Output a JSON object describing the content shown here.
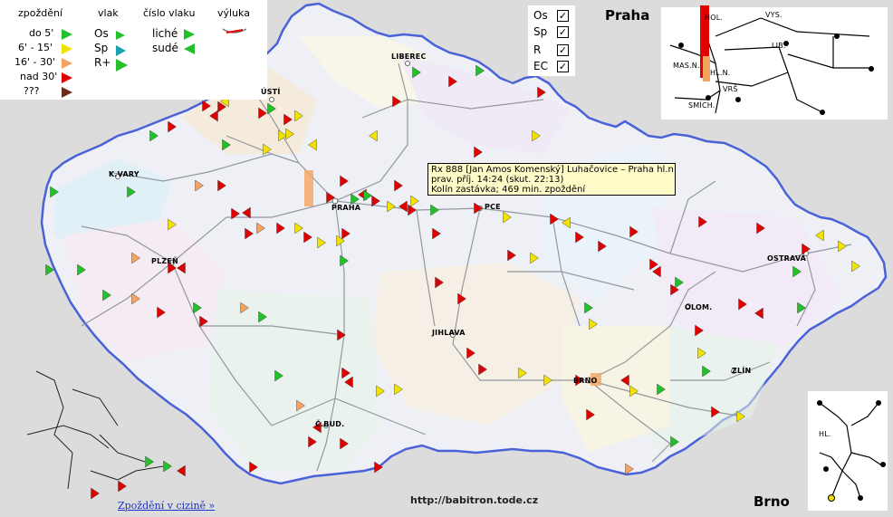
{
  "legend": {
    "delay_header": "zpoždění",
    "delays": [
      {
        "label": "do 5'",
        "color": "#22c02a",
        "icon": "delay-up-to-5-icon"
      },
      {
        "label": "6' - 15'",
        "color": "#f2e200",
        "icon": "delay-6-15-icon"
      },
      {
        "label": "16' - 30'",
        "color": "#f4a460",
        "icon": "delay-16-30-icon"
      },
      {
        "label": "nad 30'",
        "color": "#e00000",
        "icon": "delay-over-30-icon"
      },
      {
        "label": "???",
        "color": "#6b2c1a",
        "icon": "delay-unknown-icon"
      }
    ],
    "train_header": "vlak",
    "trains": [
      {
        "label": "Os",
        "color": "#22c02a",
        "icon": "train-os-icon"
      },
      {
        "label": "Sp",
        "color": "#1aa0b0",
        "icon": "train-sp-icon"
      },
      {
        "label": "R+",
        "color": "#22c02a",
        "icon": "train-r-icon"
      }
    ],
    "number_header": "číslo vlaku",
    "numbers": [
      {
        "label": "liché",
        "icon": "odd-number-icon"
      },
      {
        "label": "sudé",
        "icon": "even-number-icon"
      }
    ],
    "closure_header": "výluka"
  },
  "filters": [
    {
      "label": "Os",
      "checked": true
    },
    {
      "label": "Sp",
      "checked": true
    },
    {
      "label": "R",
      "checked": true
    },
    {
      "label": "EC",
      "checked": true
    }
  ],
  "cities": [
    {
      "name": "LIBEREC"
    },
    {
      "name": "ÚSTÍ"
    },
    {
      "name": "K.VARY"
    },
    {
      "name": "PRAHA"
    },
    {
      "name": "PCE"
    },
    {
      "name": "PLZEŇ"
    },
    {
      "name": "JIHLAVA"
    },
    {
      "name": "OSTRAVA"
    },
    {
      "name": "OLOM."
    },
    {
      "name": "BRNO"
    },
    {
      "name": "ZLÍN"
    },
    {
      "name": "Č.BUD."
    }
  ],
  "praha_inset": {
    "title": "Praha",
    "labels": [
      "HOL.",
      "VYS.",
      "LIB.",
      "MAS.N.",
      "HL.N.",
      "VRŠ",
      "SMÍCH."
    ]
  },
  "brno_inset": {
    "title": "Brno",
    "labels": [
      "HL."
    ]
  },
  "tooltip": {
    "line1": "Rx 888 [Jan Amos Komenský] Luhačovice – Praha hl.n.",
    "line2": "prav. příj. 14:24 (skut. 22:13)",
    "line3": "Kolín zastávka; 469 min. zpoždění"
  },
  "footer": {
    "foreign_link": "Zpoždění v cizině »",
    "url": "http://babitron.tode.cz"
  },
  "colors": {
    "border": "#4a62d8",
    "rail": "#8a8f96",
    "delay_green": "#22c02a",
    "delay_yellow": "#f2e200",
    "delay_orange": "#f4a460",
    "delay_red": "#e00000"
  }
}
